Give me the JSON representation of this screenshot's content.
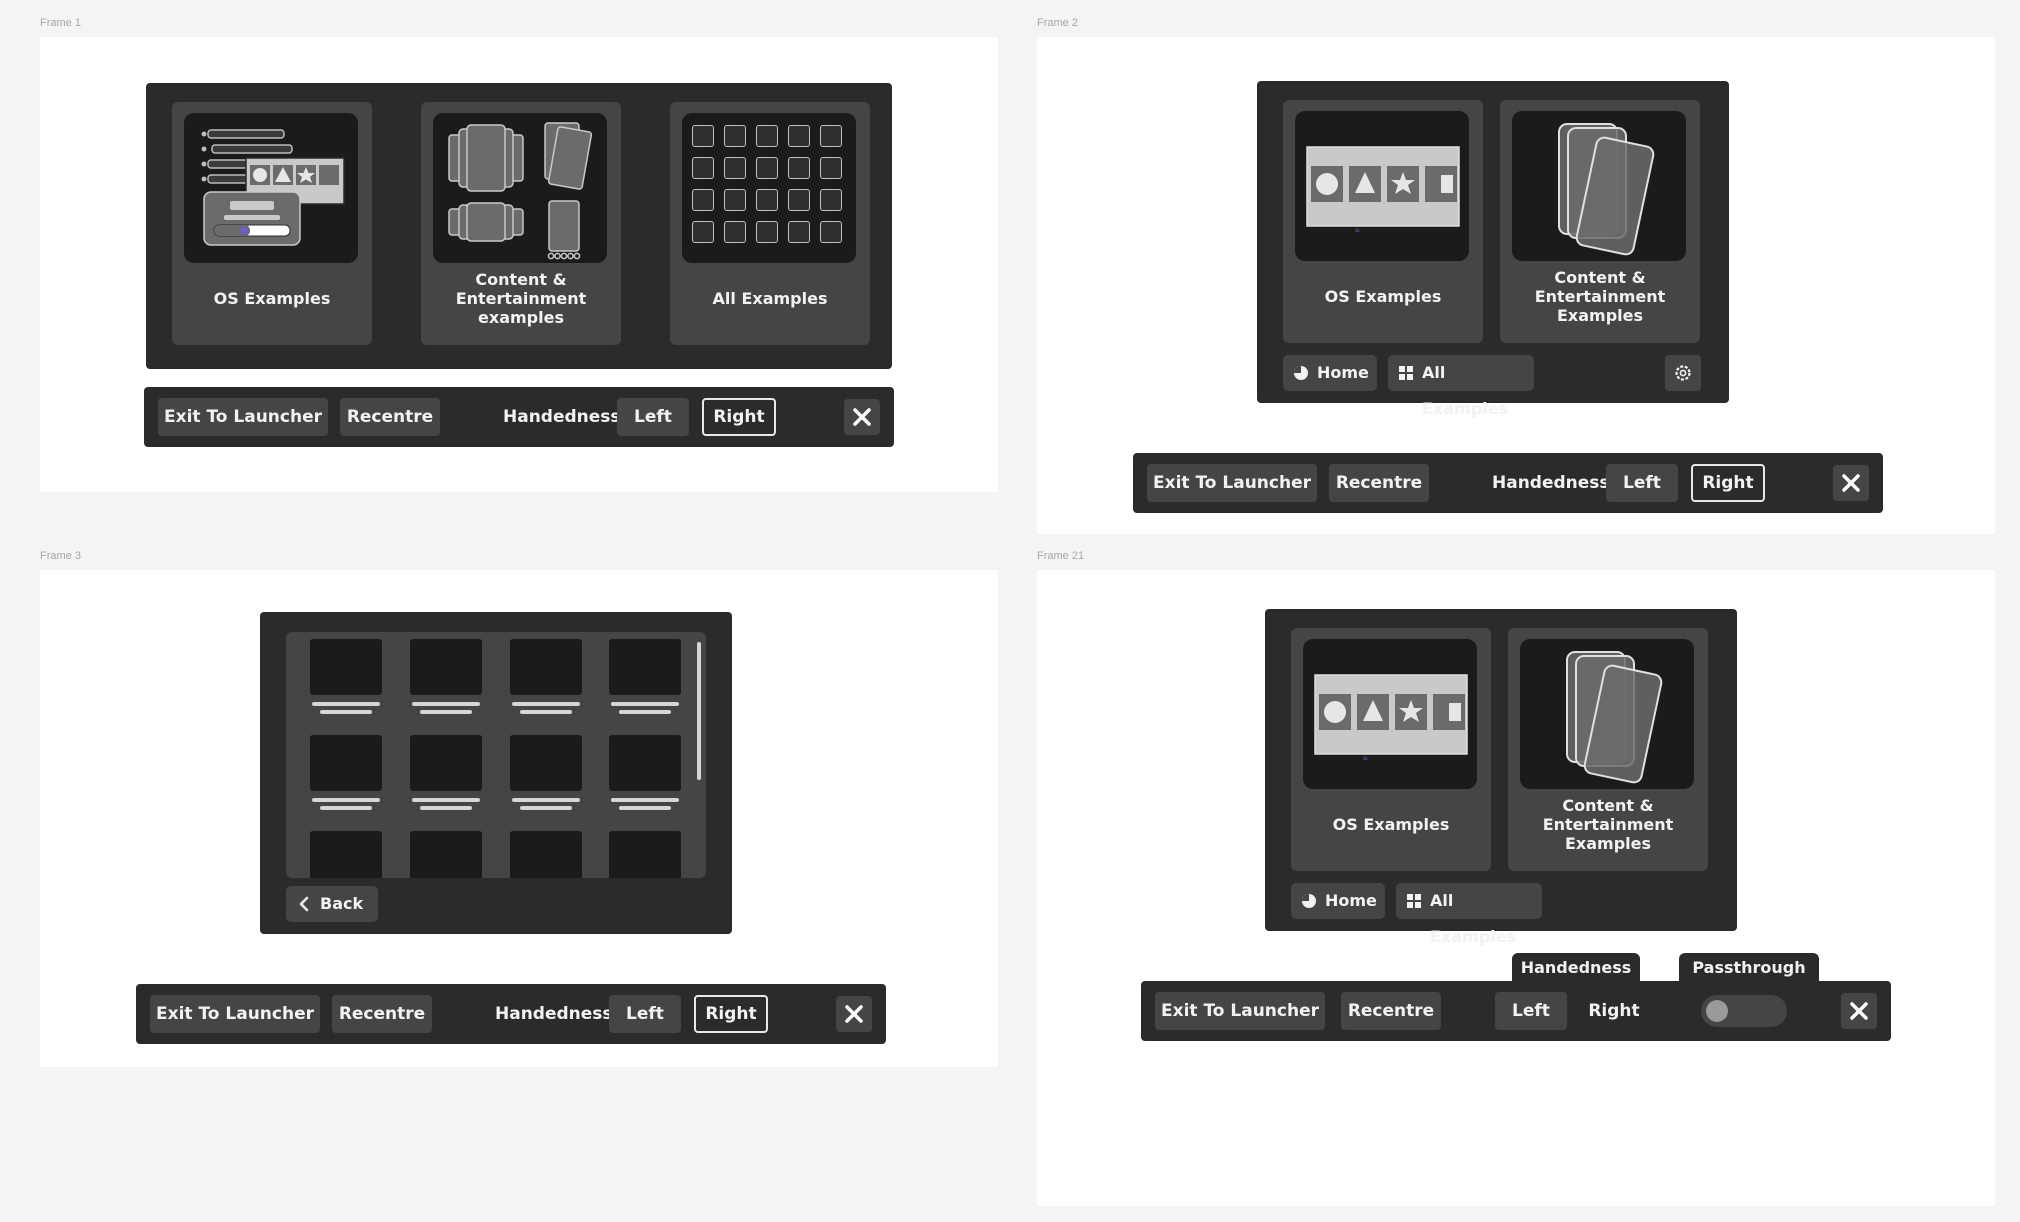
{
  "frames": {
    "f1": "Frame 1",
    "f2": "Frame 2",
    "f3": "Frame 3",
    "f21": "Frame 21"
  },
  "cards": {
    "os": "OS Examples",
    "content_lower": "Content &\nEntertainment\nexamples",
    "content_upper": "Content &\nEntertainment\nExamples",
    "all": "All Examples"
  },
  "nav": {
    "home": "Home",
    "all_examples": "All Examples",
    "back": "Back"
  },
  "bar": {
    "exit": "Exit To Launcher",
    "recentre": "Recentre",
    "handedness_label": "Handedness:",
    "left": "Left",
    "right": "Right",
    "selected": "Right"
  },
  "tabs": {
    "handedness": "Handedness",
    "passthrough": "Passthrough"
  },
  "icons": {
    "close": "close-icon",
    "gear": "gear-icon",
    "home": "home-icon",
    "grid": "grid-icon",
    "back": "chevron-left-icon"
  },
  "colors": {
    "page": "#f4f4f4",
    "frame": "#ffffff",
    "panel": "#2b2b2b",
    "card": "#454545",
    "thumb": "#1b1b1b",
    "text": "#f2f2f2"
  }
}
